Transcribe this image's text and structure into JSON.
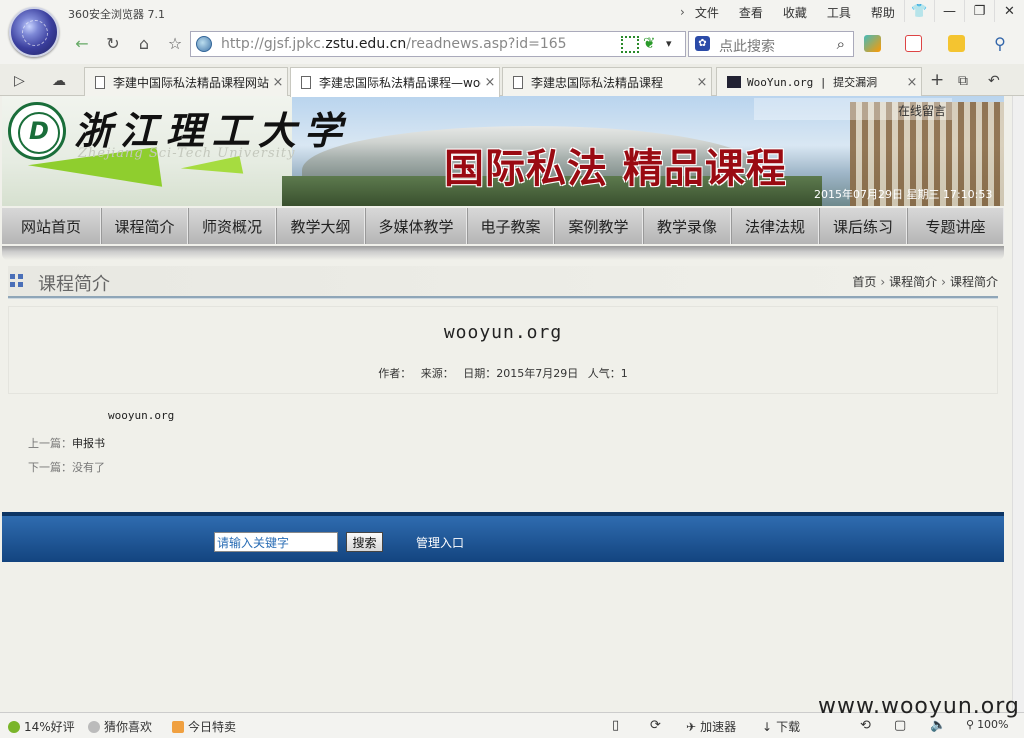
{
  "app": {
    "title": "360安全浏览器 7.1"
  },
  "menu": {
    "items": [
      "文件",
      "查看",
      "收藏",
      "工具",
      "帮助"
    ]
  },
  "address": {
    "url_prefix": "http://gjsf.jpkc.",
    "url_domain": "zstu.edu.cn",
    "url_suffix": "/readnews.asp?id=165",
    "search_placeholder": "点此搜索"
  },
  "tabs": [
    {
      "label": "李建中国际私法精品课程网站",
      "active": false
    },
    {
      "label": "李建忠国际私法精品课程—wooyun.org",
      "active": true
    },
    {
      "label": "李建忠国际私法精品课程",
      "active": false
    },
    {
      "label": "WooYun.org | 提交漏洞",
      "active": false
    }
  ],
  "banner": {
    "university_cn": "浙江理工大学",
    "university_en": "Zhejiang Sci-Tech University",
    "course_title": "国际私法  精品课程",
    "guestbook": "在线留言",
    "datetime": "2015年07月29日 星期三 17:10:53"
  },
  "nav": {
    "items": [
      "网站首页",
      "课程简介",
      "师资概况",
      "教学大纲",
      "多媒体教学",
      "电子教案",
      "案例教学",
      "教学录像",
      "法律法规",
      "课后练习",
      "专题讲座"
    ]
  },
  "section": {
    "title": "课程简介",
    "breadcrumb": [
      "首页",
      "课程简介",
      "课程简介"
    ]
  },
  "article": {
    "title": "wooyun.org",
    "meta_author": "作者：",
    "meta_source": "来源：",
    "meta_date": "日期：2015年7月29日",
    "meta_views": "人气：1",
    "body": "wooyun.org",
    "prev_label": "上一篇：",
    "prev_link": "申报书",
    "next_label": "下一篇：",
    "next_text": "没有了"
  },
  "footer": {
    "keyword_placeholder": "请输入关键字",
    "search_button": "搜索",
    "admin_link": "管理入口"
  },
  "status": {
    "rating": "14%好评",
    "guess": "猜你喜欢",
    "deals": "今日特卖",
    "accelerator": "加速器",
    "download": "下载",
    "zoom": "100%"
  },
  "watermark": "www.wooyun.org",
  "colors": {
    "nav_bg": "#b5b5b5",
    "footer_bg": "#13447f",
    "banner_title": "#9a0a12",
    "section_icon": "#4a6fb8"
  }
}
